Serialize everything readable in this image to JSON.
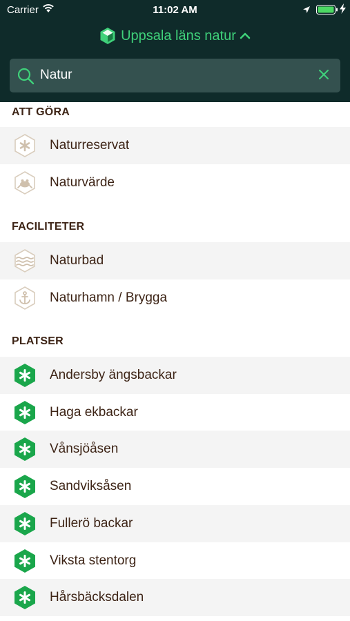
{
  "status_bar": {
    "carrier": "Carrier",
    "time": "11:02 AM"
  },
  "header": {
    "title": "Uppsala läns natur",
    "title_color": "#3fd17a",
    "background": "#0f2b2a"
  },
  "search": {
    "value": "Natur",
    "icons": [
      "search-icon",
      "close-icon"
    ]
  },
  "sections": {
    "att_gora": {
      "title": "ATT GÖRA",
      "items": [
        {
          "label": "Naturreservat",
          "icon": "asterisk-hex-icon"
        },
        {
          "label": "Naturvärde",
          "icon": "frog-hex-icon"
        }
      ]
    },
    "faciliteter": {
      "title": "FACILITETER",
      "items": [
        {
          "label": "Naturbad",
          "icon": "water-hex-icon"
        },
        {
          "label": "Naturhamn / Brygga",
          "icon": "anchor-hex-icon"
        }
      ]
    },
    "platser": {
      "title": "PLATSER",
      "items": [
        {
          "label": "Andersby ängsbackar",
          "icon": "green-asterisk-hex-icon"
        },
        {
          "label": "Haga ekbackar",
          "icon": "green-asterisk-hex-icon"
        },
        {
          "label": "Vånsjöåsen",
          "icon": "green-asterisk-hex-icon"
        },
        {
          "label": "Sandviksåsen",
          "icon": "green-asterisk-hex-icon"
        },
        {
          "label": "Fullerö backar",
          "icon": "green-asterisk-hex-icon"
        },
        {
          "label": "Viksta stentorg",
          "icon": "green-asterisk-hex-icon"
        },
        {
          "label": "Hårsbäcksdalen",
          "icon": "green-asterisk-hex-icon"
        }
      ]
    }
  },
  "colors": {
    "text_brown": "#3d2416",
    "place_green": "#1aa64b",
    "outline_beige": "#d9cdbd",
    "alt_row": "#f4f4f4"
  }
}
